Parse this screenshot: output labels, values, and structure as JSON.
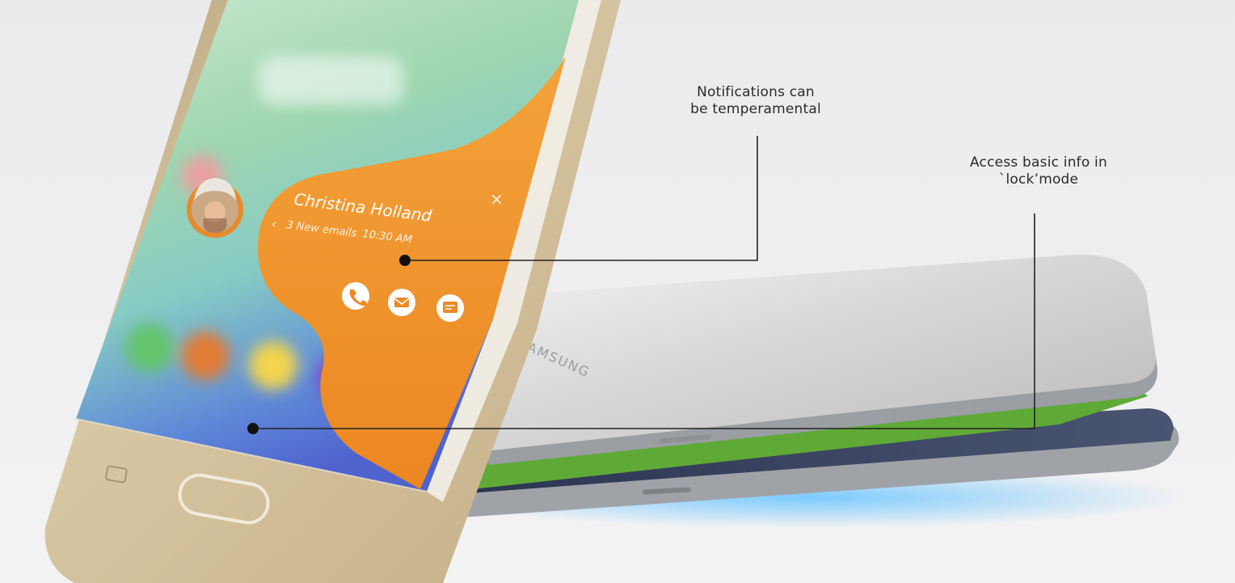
{
  "callouts": {
    "notifications": {
      "line1": "Notifications can",
      "line2": "be temperamental"
    },
    "lock_mode": {
      "line1": "Access basic info in",
      "line2": "`lock’mode"
    }
  },
  "notification_card": {
    "contact_name": "Christina Holland",
    "summary": "3 New emails",
    "time": "10:30 AM",
    "close_glyph": "×",
    "back_glyph": "‹",
    "actions": [
      "phone-icon",
      "email-icon",
      "message-icon"
    ]
  },
  "brand_text": "SAMSUNG",
  "colors": {
    "background": "#e9e9ec",
    "edge_panel_orange": "#ee8f2a",
    "phone_gold": "#cdb893",
    "screen_green": "#a9d9b4",
    "leader_line": "#222222"
  }
}
